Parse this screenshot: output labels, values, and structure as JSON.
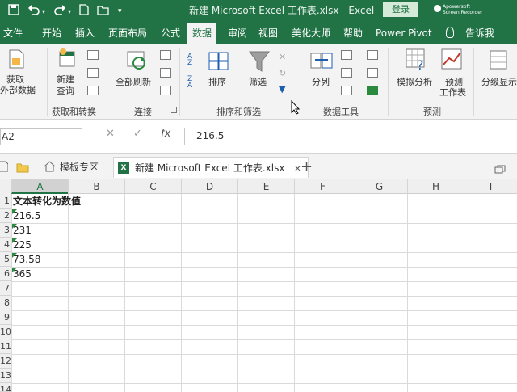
{
  "titlebar": {
    "title": "新建 Microsoft Excel 工作表.xlsx  -  Excel",
    "login": "登录",
    "recorder_line1": "Apowersoft",
    "recorder_line2": "Screen Recorder"
  },
  "menu": {
    "tabs": [
      "文件",
      "开始",
      "插入",
      "页面布局",
      "公式",
      "数据",
      "审阅",
      "视图",
      "美化大师",
      "帮助",
      "Power Pivot"
    ],
    "active": "数据",
    "tell_me": "告诉我"
  },
  "ribbon": {
    "get_data": [
      "获取",
      "外部数据"
    ],
    "new_query": [
      "新建",
      "查询"
    ],
    "group_get_transform": "获取和转换",
    "refresh_all": "全部刷新",
    "group_connections": "连接",
    "sort": "排序",
    "filter": "筛选",
    "group_sort_filter": "排序和筛选",
    "text_to_columns": "分列",
    "group_data_tools": "数据工具",
    "what_if": "模拟分析",
    "forecast_sheet": [
      "预测",
      "工作表"
    ],
    "group_forecast": "预测",
    "outline": "分级显示",
    "sort_az_1": "A",
    "sort_az_2": "Z",
    "sort_za_1": "Z",
    "sort_za_2": "A"
  },
  "formula_bar": {
    "name_box": "A2",
    "cancel_symbol": "✕",
    "enter_symbol": "✓",
    "fx_symbol": "fx",
    "content": "216.5"
  },
  "file_tabs": {
    "template_tab": "模板专区",
    "active_tab": "新建 Microsoft Excel 工作表.xlsx",
    "close_symbol": "✕",
    "add_symbol": "+",
    "xl_badge": "X"
  },
  "sheet": {
    "columns": [
      "A",
      "B",
      "C",
      "D",
      "E",
      "F",
      "G",
      "H",
      "I"
    ],
    "selected_column": "A",
    "row_numbers": [
      "1",
      "2",
      "3",
      "4",
      "5",
      "6",
      "7",
      "8",
      "9",
      "10",
      "11",
      "12",
      "13",
      "14"
    ],
    "cells": [
      {
        "row": "1",
        "value": "文本转化为数值"
      },
      {
        "row": "2",
        "value": "216.5"
      },
      {
        "row": "3",
        "value": "231"
      },
      {
        "row": "4",
        "value": "225"
      },
      {
        "row": "5",
        "value": "73.58"
      },
      {
        "row": "6",
        "value": "365"
      }
    ]
  },
  "colors": {
    "excel_green": "#217346",
    "error_indicator": "#2a8a3e"
  }
}
